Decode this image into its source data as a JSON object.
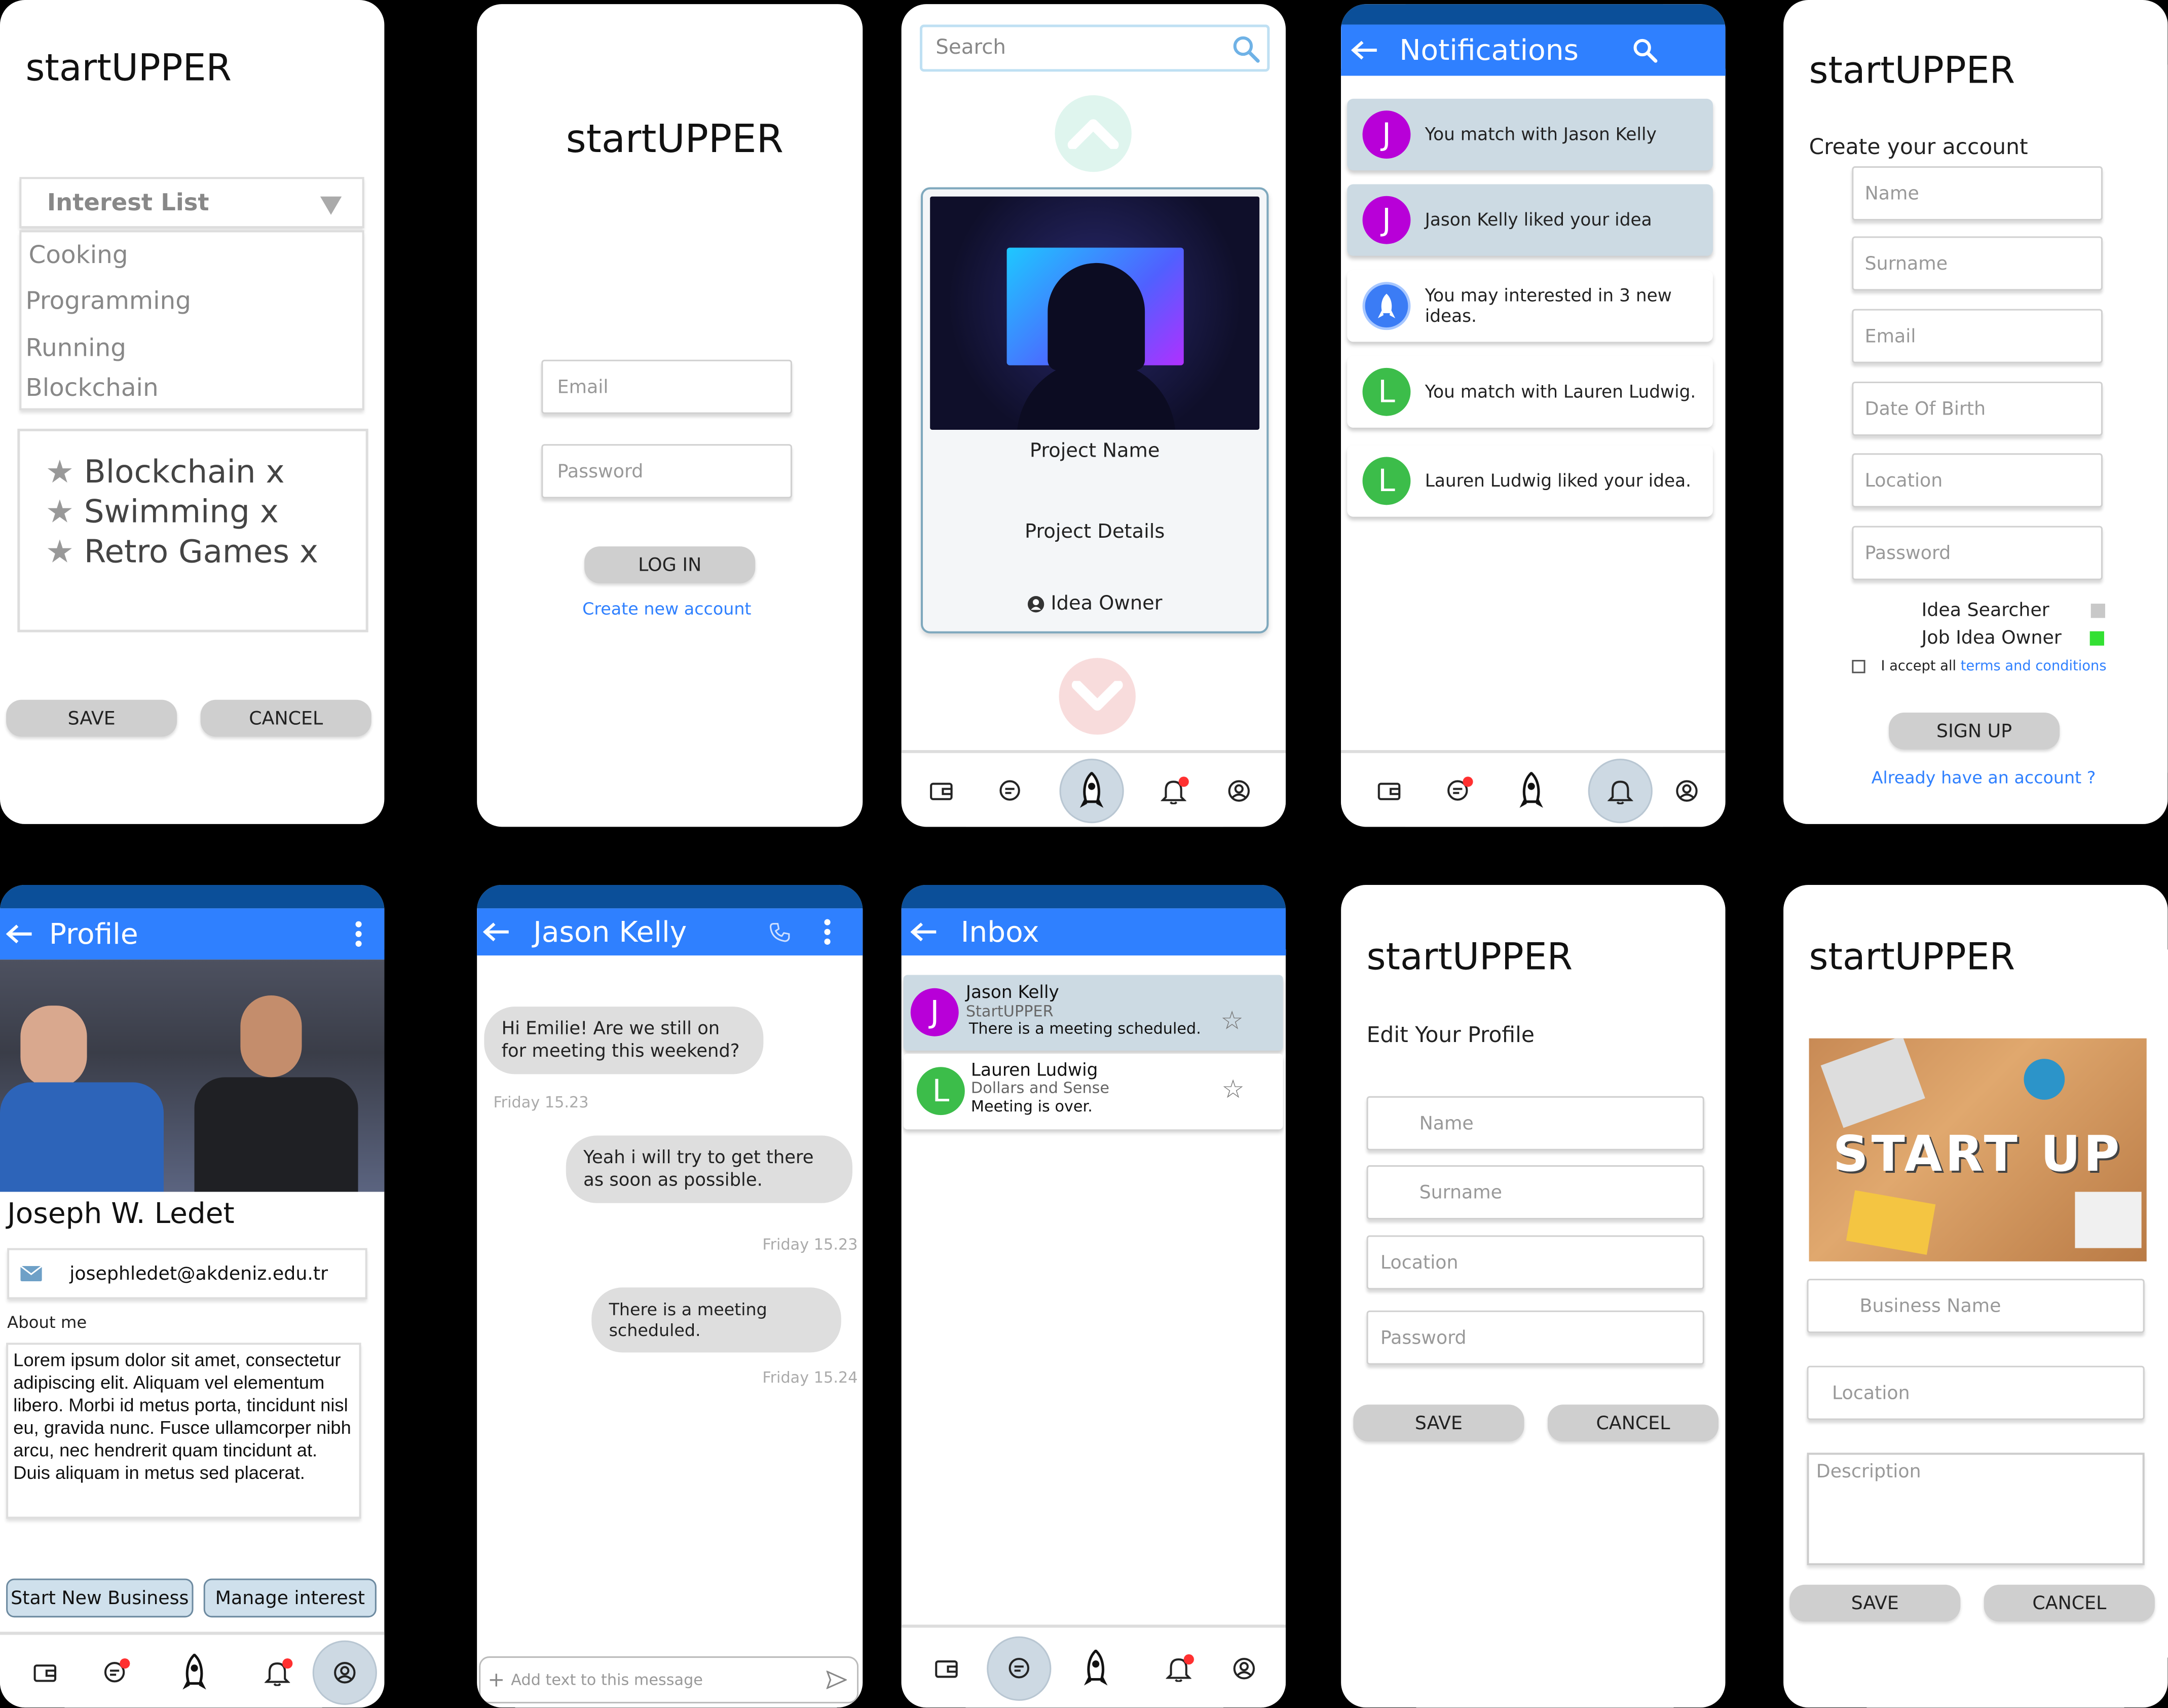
{
  "brand": "startUPPER",
  "interests": {
    "dropdown_label": "Interest List",
    "options": [
      "Cooking",
      "Programming",
      "Running",
      "Blockchain"
    ],
    "selected": [
      "Blockchain x",
      "Swimming x",
      "Retro Games x"
    ],
    "save_label": "SAVE",
    "cancel_label": "CANCEL"
  },
  "login": {
    "email_placeholder": "Email",
    "password_placeholder": "Password",
    "login_label": "LOG IN",
    "create_account_link": "Create new account"
  },
  "discover": {
    "search_placeholder": "Search",
    "project_name": "Project Name",
    "project_details": "Project Details",
    "idea_owner": "Idea Owner"
  },
  "notifications": {
    "title": "Notifications",
    "items": [
      {
        "initial": "J",
        "text": "You match with Jason Kelly",
        "highlight": true,
        "color": "#b800d8"
      },
      {
        "initial": "J",
        "text": "Jason Kelly liked your idea",
        "highlight": true,
        "color": "#b800d8"
      },
      {
        "initial": "",
        "text": "You may interested in 3 new ideas.",
        "highlight": false,
        "color": "#3b7cf5"
      },
      {
        "initial": "L",
        "text": "You match with Lauren Ludwig.",
        "highlight": false,
        "color": "#3cbd4a"
      },
      {
        "initial": "L",
        "text": "Lauren Ludwig liked your idea.",
        "highlight": false,
        "color": "#3cbd4a"
      }
    ]
  },
  "signup": {
    "subtitle": "Create your account",
    "fields": [
      "Name",
      "Surname",
      "Email",
      "Date Of Birth",
      "Location",
      "Password"
    ],
    "role_searcher": "Idea Searcher",
    "role_owner": "Job Idea Owner",
    "accept_prefix": "I accept all",
    "terms_link": "terms and conditions",
    "signup_label": "SIGN UP",
    "already_link": "Already have an account ?"
  },
  "profile": {
    "title": "Profile",
    "name": "Joseph W. Ledet",
    "email": "josephledet@akdeniz.edu.tr",
    "about_label": "About me",
    "about_text": "Lorem ipsum dolor sit amet, consectetur adipiscing elit. Aliquam vel elementum libero. Morbi id metus porta, tincidunt nisl eu, gravida nunc. Fusce ullamcorper nibh arcu, nec hendrerit quam tincidunt at. Duis aliquam in metus sed placerat.",
    "start_business_label": "Start New Business",
    "manage_interest_label": "Manage interest"
  },
  "chat": {
    "title": "Jason Kelly",
    "messages": [
      {
        "text": "Hi Emilie! Are we still on for meeting this weekend?",
        "time": "Friday 15.23"
      },
      {
        "text": "Yeah i will try to get there as soon as possible.",
        "time": "Friday 15.23"
      },
      {
        "text": "There is a meeting scheduled.",
        "time": "Friday 15.24"
      }
    ],
    "input_placeholder": "Add text to this message"
  },
  "inbox": {
    "title": "Inbox",
    "items": [
      {
        "initial": "J",
        "name": "Jason Kelly",
        "company": "StartUPPER",
        "preview": "There is a meeting scheduled.",
        "color": "#b800d8"
      },
      {
        "initial": "L",
        "name": "Lauren Ludwig",
        "company": "Dollars and Sense",
        "preview": "Meeting is over.",
        "color": "#3cbd4a"
      }
    ]
  },
  "edit_profile": {
    "subtitle": "Edit Your Profile",
    "fields": [
      "Name",
      "Surname",
      "Location",
      "Password"
    ],
    "save_label": "SAVE",
    "cancel_label": "CANCEL"
  },
  "business": {
    "banner_text": "START UP",
    "fields": [
      "Business Name",
      "Location"
    ],
    "description_placeholder": "Description",
    "save_label": "SAVE",
    "cancel_label": "CANCEL"
  }
}
